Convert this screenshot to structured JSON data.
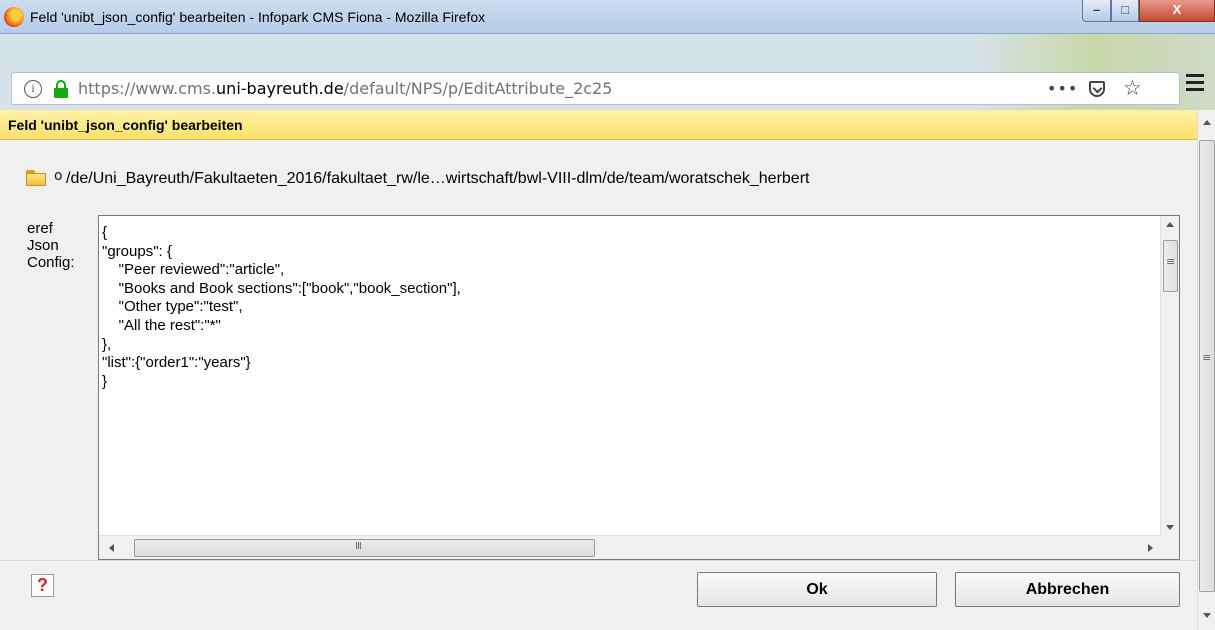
{
  "window": {
    "title": "Feld 'unibt_json_config' bearbeiten - Infopark CMS Fiona - Mozilla Firefox",
    "buttons": {
      "minimize": "–",
      "maximize": "□",
      "close": "X"
    }
  },
  "urlbar": {
    "url_prefix": "https://www.cms.",
    "url_domain": "uni-bayreuth.de",
    "url_path": "/default/NPS/p/EditAttribute_2c25",
    "icons": [
      "info-icon",
      "lock-icon",
      "page-actions-dots-icon",
      "pocket-icon",
      "bookmark-star-icon",
      "hamburger-menu-icon"
    ],
    "dots": "•••",
    "star": "☆"
  },
  "dialog": {
    "header": "Feld 'unibt_json_config' bearbeiten",
    "path_bullet": "o",
    "path": "/de/Uni_Bayreuth/Fakultaeten_2016/fakultaet_rw/le…wirtschaft/bwl-VIII-dlm/de/team/woratschek_herbert",
    "field_label": "eref\nJson\nConfig:",
    "editor_value": "{\n\"groups\": {\n    \"Peer reviewed\":\"article\",\n    \"Books and Book sections\":[\"book\",\"book_section\"],\n    \"Other type\":\"test\",\n    \"All the rest\":\"*\"\n},\n\"list\":{\"order1\":\"years\"}\n}",
    "help": "?",
    "ok_label": "Ok",
    "cancel_label": "Abbrechen"
  },
  "colors": {
    "header_yellow": "#fbe16a",
    "lock_green": "#12a812",
    "help_red": "#dd2222"
  }
}
